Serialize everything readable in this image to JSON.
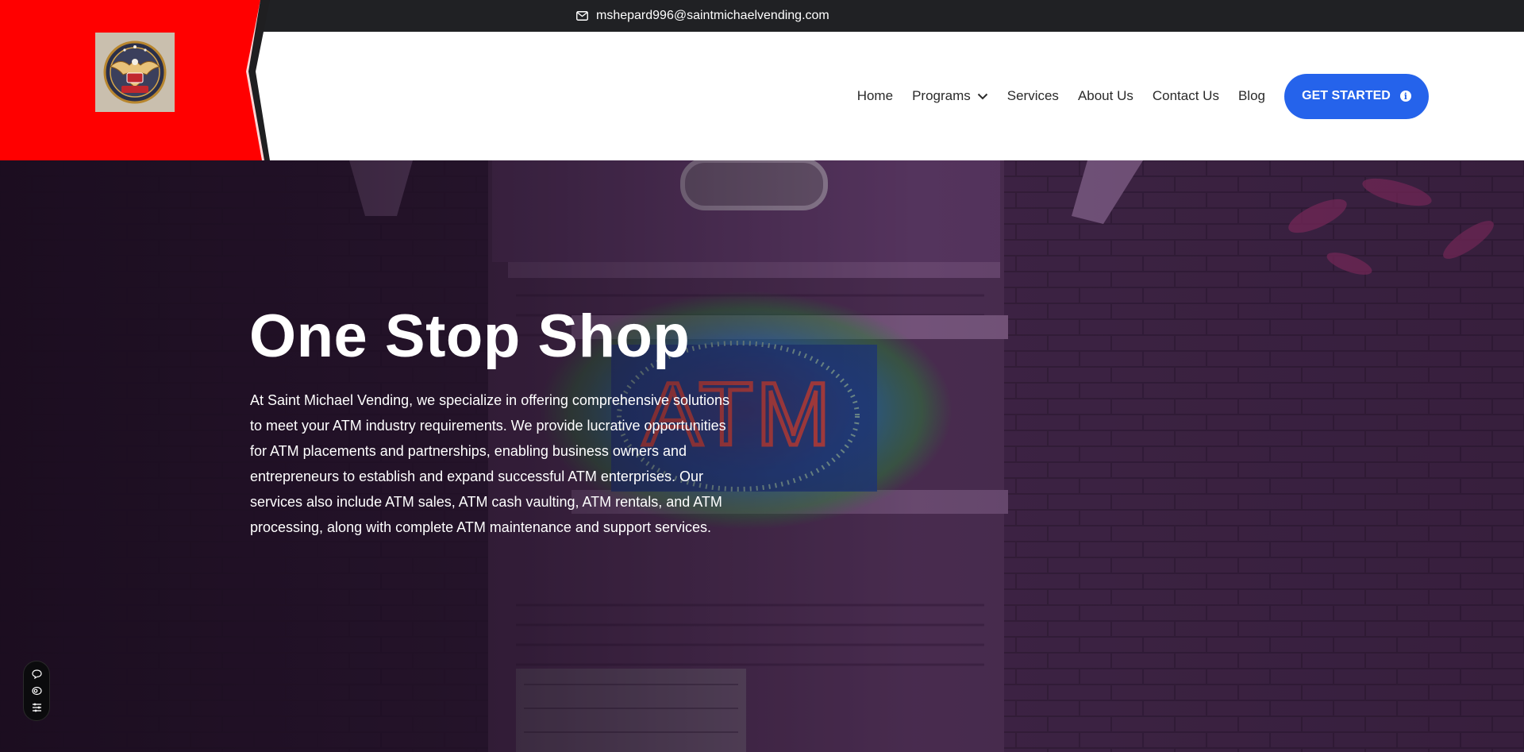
{
  "topbar": {
    "email": "mshepard996@saintmichaelvending.com",
    "email_icon": "envelope-icon"
  },
  "header": {
    "logo_alt": "eagle-emblem-logo",
    "accent_color": "#ff0000",
    "nav": {
      "home": "Home",
      "programs": "Programs",
      "services": "Services",
      "about": "About Us",
      "contact": "Contact Us",
      "blog": "Blog"
    },
    "cta_label": "GET STARTED",
    "cta_color": "#2563eb",
    "cta_icon": "info-icon"
  },
  "hero": {
    "title": "One Stop Shop",
    "body": "At Saint Michael Vending, we specialize in offering comprehensive solutions to meet your ATM industry requirements. We provide lucrative opportunities for ATM placements and partnerships, enabling business owners and entrepreneurs to establish and expand successful ATM enterprises. Our services also include ATM sales, ATM cash vaulting, ATM rentals, and ATM processing, along with complete ATM maintenance and support services.",
    "sign_text": "ATM"
  },
  "widget": {
    "icons": [
      "chat-bubble-icon",
      "accessibility-icon",
      "settings-list-icon"
    ]
  }
}
